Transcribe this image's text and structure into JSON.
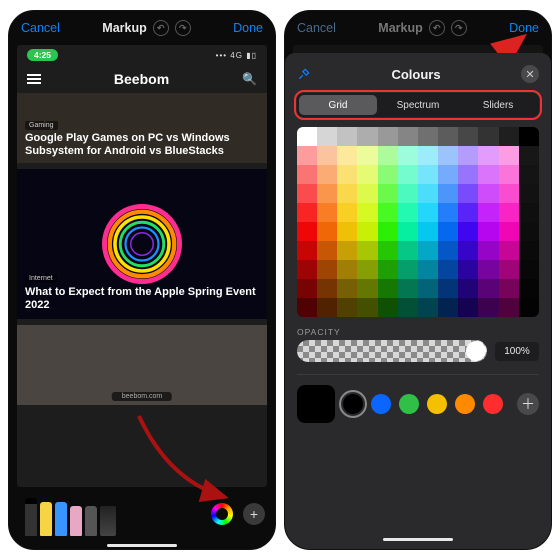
{
  "nav": {
    "cancel": "Cancel",
    "title": "Markup",
    "done": "Done"
  },
  "screenshot": {
    "status_time": "4:25",
    "status_net": "4G",
    "app_title": "Beebom",
    "articles": [
      {
        "category": "Gaming",
        "headline": "Google Play Games on PC vs Windows Subsystem for Android vs BlueStacks"
      },
      {
        "category": "Internet",
        "headline": "What to Expect from the Apple Spring Event 2022"
      }
    ],
    "footer_url": "beebom.com"
  },
  "toolrow": {
    "tools": [
      "pen",
      "marker",
      "pencil",
      "eraser",
      "lasso",
      "ruler"
    ],
    "color_picker": "colour-wheel",
    "add": "+"
  },
  "colours": {
    "title": "Colours",
    "tabs": [
      "Grid",
      "Spectrum",
      "Sliders"
    ],
    "selected_tab": "Grid",
    "opacity_label": "OPACITY",
    "opacity_value": "100%",
    "swatch_current": "#000000",
    "swatches": [
      "#000000",
      "#0a66ff",
      "#30c048",
      "#f5c000",
      "#ff8a00",
      "#ff2d2d"
    ]
  }
}
